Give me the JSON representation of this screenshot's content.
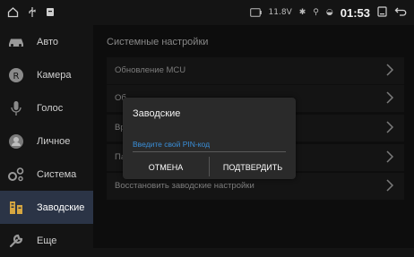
{
  "status_bar": {
    "icons": [
      "home-icon",
      "usb-icon",
      "notification-icon",
      "battery-icon",
      "bluetooth-icon",
      "location-icon",
      "wifi-icon",
      "screen-icon",
      "back-icon"
    ],
    "mini_text": "11.8V",
    "time": "01:53"
  },
  "sidebar": {
    "items": [
      {
        "label": "Авто",
        "icon": "car-icon"
      },
      {
        "label": "Камера",
        "icon": "camera-icon"
      },
      {
        "label": "Голос",
        "icon": "microphone-icon"
      },
      {
        "label": "Личное",
        "icon": "person-icon"
      },
      {
        "label": "Система",
        "icon": "settings-icon"
      },
      {
        "label": "Заводские",
        "icon": "factory-icon",
        "active": true
      },
      {
        "label": "Еще",
        "icon": "wrench-icon"
      }
    ]
  },
  "main": {
    "title": "Системные настройки",
    "rows": [
      {
        "label": "Обновление MCU"
      },
      {
        "label": "Об"
      },
      {
        "label": "Вр"
      },
      {
        "label": "Па"
      },
      {
        "label": "Восстановить заводские настройки"
      }
    ]
  },
  "dialog": {
    "title": "Заводские",
    "input_placeholder": "Введите свой PIN-код",
    "input_value": "",
    "cancel_label": "ОТМЕНА",
    "confirm_label": "ПОДТВЕРДИТЬ"
  },
  "colors": {
    "background": "#141414",
    "active_item": "#2b3446",
    "accent_placeholder": "#3a8fd9",
    "row_bg": "#1f1f1f"
  }
}
